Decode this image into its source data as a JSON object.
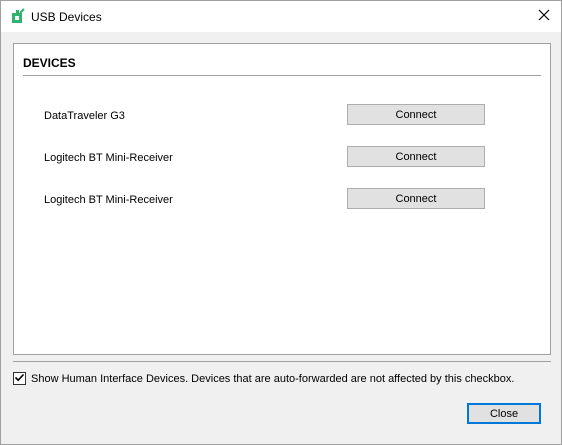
{
  "window": {
    "title": "USB Devices"
  },
  "devices_section": {
    "title": "DEVICES",
    "devices": [
      {
        "name": "DataTraveler G3",
        "button_label": "Connect"
      },
      {
        "name": "Logitech BT Mini-Receiver",
        "button_label": "Connect"
      },
      {
        "name": "Logitech BT Mini-Receiver",
        "button_label": "Connect"
      }
    ]
  },
  "hid_option": {
    "checked": true,
    "label": "Show Human Interface Devices. Devices that are auto-forwarded are not affected by this checkbox."
  },
  "footer": {
    "close_label": "Close"
  },
  "colors": {
    "accent": "#0078d7",
    "icon_green": "#2fb36f"
  }
}
